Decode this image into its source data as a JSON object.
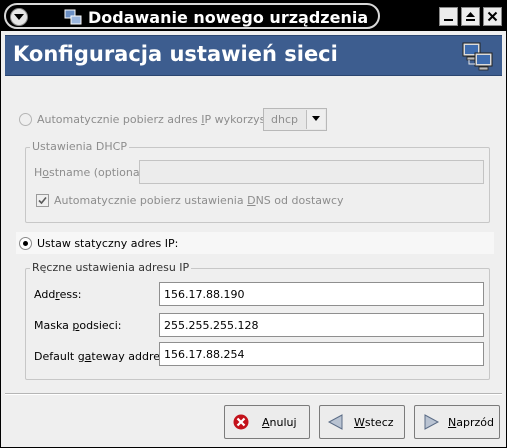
{
  "window": {
    "title": "Dodawanie nowego urządzenia",
    "controls": [
      "minimize-icon",
      "maximize-icon",
      "close-icon"
    ]
  },
  "header": {
    "title": "Konfiguracja ustawień sieci",
    "icon": "network-computers-icon",
    "background": "#3d5d8f"
  },
  "auto": {
    "label": "Automatycznie pobierz adres IP wykorzystując:",
    "selected": false,
    "method": "dhcp"
  },
  "dhcp": {
    "group_title": "Ustawienia DHCP",
    "hostname_label": "Hostname (optional):",
    "hostname_value": "",
    "dns_label": "Automatycznie pobierz ustawienia DNS od dostawcy",
    "dns_checked": true
  },
  "static": {
    "label": "Ustaw statyczny adres IP:",
    "selected": true,
    "group_title": "Ręczne ustawienia adresu IP",
    "fields": [
      {
        "label": "Address:",
        "value": "156.17.88.190"
      },
      {
        "label": "Maska podsieci:",
        "value": "255.255.255.128"
      },
      {
        "label": "Default gateway address:",
        "value": "156.17.88.254"
      }
    ]
  },
  "buttons": {
    "cancel": "Anuluj",
    "back": "Wstecz",
    "next": "Naprzód"
  }
}
